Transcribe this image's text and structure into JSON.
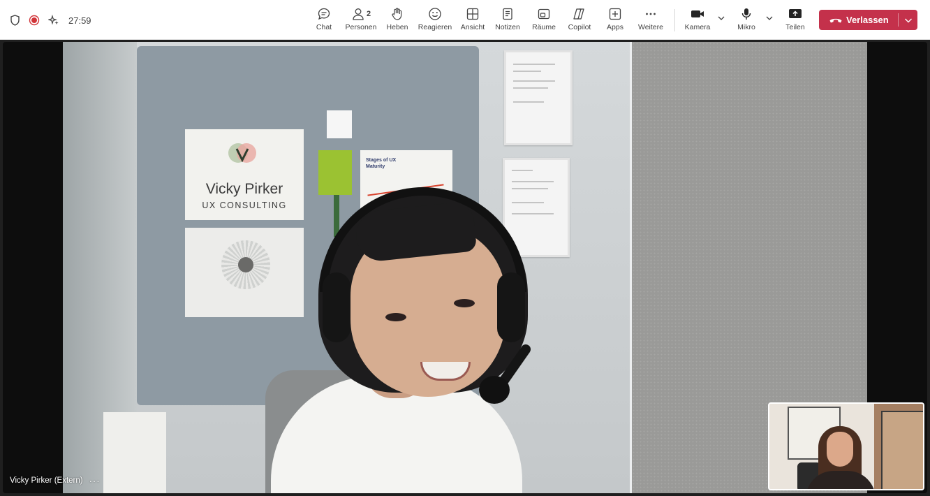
{
  "meeting": {
    "timer": "27:59",
    "colors": {
      "leave": "#c4314b",
      "accent": "#5b5fc7",
      "record": "#d13438"
    }
  },
  "left_icons": [
    "shield-icon",
    "record-icon",
    "sparkle-icon"
  ],
  "toolbar": {
    "chat": "Chat",
    "people": "Personen",
    "people_count": "2",
    "raise": "Heben",
    "react": "Reagieren",
    "view": "Ansicht",
    "notes": "Notizen",
    "rooms": "Räume",
    "copilot": "Copilot",
    "apps": "Apps",
    "more": "Weitere",
    "camera": "Kamera",
    "mic": "Mikro",
    "share": "Teilen",
    "leave": "Verlassen"
  },
  "participant": {
    "name": "Vicky Pirker (Extern)",
    "more": "···"
  },
  "background": {
    "poster_title": "Vicky Pirker",
    "poster_subtitle": "UX CONSULTING",
    "poster_stages": "Stages of UX Maturity"
  }
}
